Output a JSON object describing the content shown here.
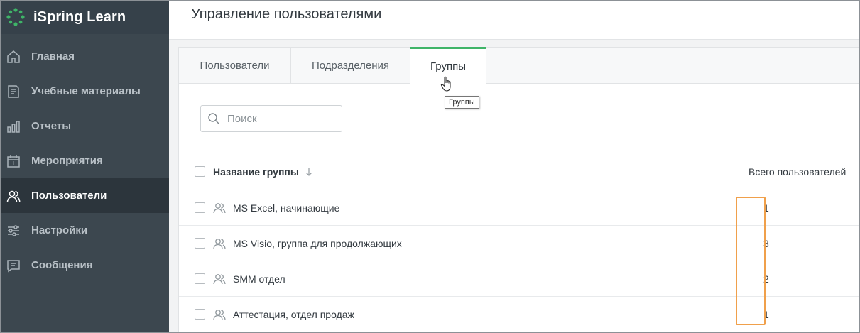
{
  "app": {
    "name": "iSpring Learn",
    "brand_color": "#3fb468"
  },
  "sidebar": {
    "items": [
      {
        "label": "Главная",
        "icon": "home-icon"
      },
      {
        "label": "Учебные материалы",
        "icon": "document-icon"
      },
      {
        "label": "Отчеты",
        "icon": "bar-chart-icon"
      },
      {
        "label": "Мероприятия",
        "icon": "calendar-icon"
      },
      {
        "label": "Пользователи",
        "icon": "users-icon",
        "active": true
      },
      {
        "label": "Настройки",
        "icon": "sliders-icon"
      },
      {
        "label": "Сообщения",
        "icon": "message-icon"
      }
    ]
  },
  "header": {
    "title": "Управление пользователями"
  },
  "tabs": [
    {
      "label": "Пользователи"
    },
    {
      "label": "Подразделения"
    },
    {
      "label": "Группы",
      "active": true
    }
  ],
  "tooltip": {
    "text": "Группы"
  },
  "search": {
    "placeholder": "Поиск",
    "value": ""
  },
  "table": {
    "columns": {
      "name": "Название группы",
      "count": "Всего пользователей"
    },
    "rows": [
      {
        "name": "MS Excel, начинающие",
        "count": "1"
      },
      {
        "name": "MS Visio, группа для продолжающих",
        "count": "3"
      },
      {
        "name": "SMM отдел",
        "count": "2"
      },
      {
        "name": "Аттестация, отдел продаж",
        "count": "1"
      }
    ]
  },
  "colors": {
    "sidebar_bg": "#3c474f",
    "active_tab_border": "#3fb468",
    "highlight": "#f0a04b"
  }
}
